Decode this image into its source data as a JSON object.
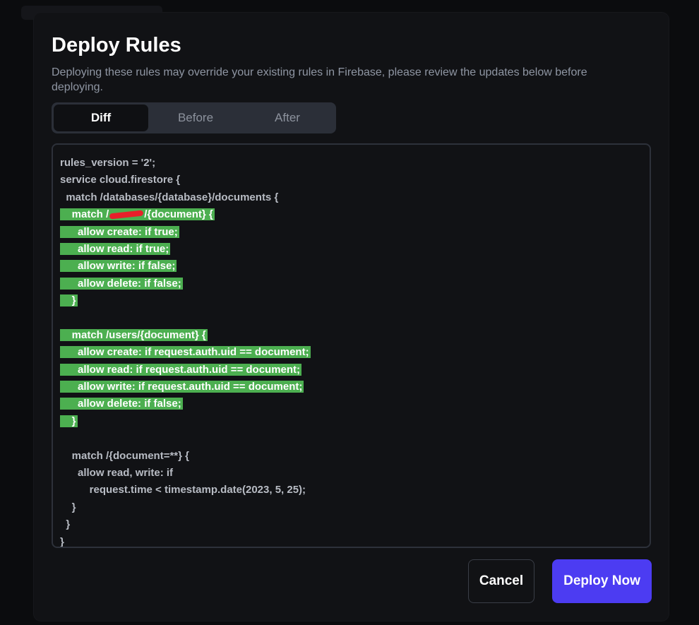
{
  "dialog": {
    "title": "Deploy Rules",
    "subtitle": "Deploying these rules may override your existing rules in Firebase, please review the updates below before deploying."
  },
  "tabs": [
    {
      "label": "Diff",
      "active": true
    },
    {
      "label": "Before",
      "active": false
    },
    {
      "label": "After",
      "active": false
    }
  ],
  "code_lines": [
    {
      "text": "rules_version = '2';",
      "added": false
    },
    {
      "text": "service cloud.firestore {",
      "added": false
    },
    {
      "text": "  match /databases/{database}/documents {",
      "added": false
    },
    {
      "text": "    match /[redacted]/{document} {",
      "added": true,
      "redacted": true
    },
    {
      "text": "      allow create: if true;",
      "added": true
    },
    {
      "text": "      allow read: if true;",
      "added": true
    },
    {
      "text": "      allow write: if false;",
      "added": true
    },
    {
      "text": "      allow delete: if false;",
      "added": true
    },
    {
      "text": "    }",
      "added": true
    },
    {
      "text": "",
      "added": false
    },
    {
      "text": "    match /users/{document} {",
      "added": true
    },
    {
      "text": "      allow create: if request.auth.uid == document;",
      "added": true
    },
    {
      "text": "      allow read: if request.auth.uid == document;",
      "added": true
    },
    {
      "text": "      allow write: if request.auth.uid == document;",
      "added": true
    },
    {
      "text": "      allow delete: if false;",
      "added": true
    },
    {
      "text": "    }",
      "added": true
    },
    {
      "text": "",
      "added": false
    },
    {
      "text": "    match /{document=**} {",
      "added": false
    },
    {
      "text": "      allow read, write: if",
      "added": false
    },
    {
      "text": "          request.time < timestamp.date(2023, 5, 25);",
      "added": false
    },
    {
      "text": "    }",
      "added": false
    },
    {
      "text": "  }",
      "added": false
    },
    {
      "text": "}",
      "added": false
    }
  ],
  "buttons": {
    "cancel": "Cancel",
    "deploy": "Deploy Now"
  },
  "colors": {
    "added_highlight": "#4caf50",
    "primary_button": "#4c3cf2",
    "redaction_mark": "#e8202a"
  }
}
